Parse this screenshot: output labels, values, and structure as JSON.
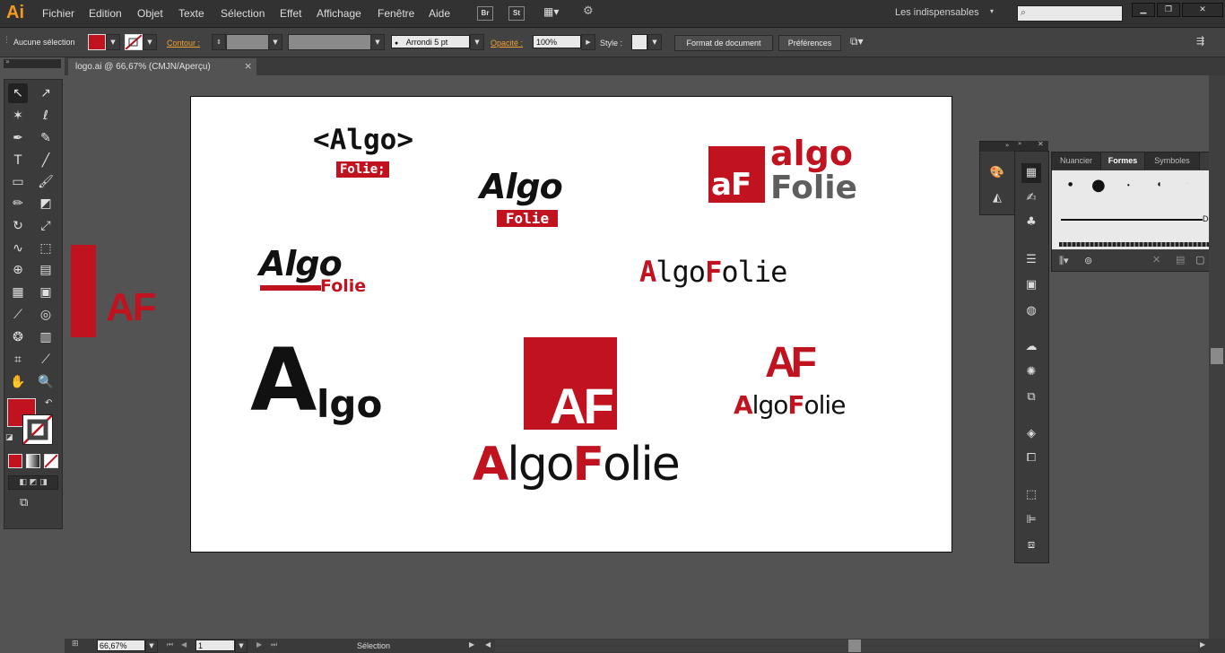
{
  "app": {
    "logo": "Ai"
  },
  "menu": [
    "Fichier",
    "Edition",
    "Objet",
    "Texte",
    "Sélection",
    "Effet",
    "Affichage",
    "Fenêtre",
    "Aide"
  ],
  "menubar_buttons": {
    "bridge": "Br",
    "stock": "St"
  },
  "workspace": "Les indispensables",
  "window_controls": {
    "minimize": "▁",
    "restore": "❐",
    "close": "✕"
  },
  "control_bar": {
    "selection_status": "Aucune sélection",
    "contour_label": "Contour :",
    "brush_value": "Arrondi 5 pt",
    "opacity_label": "Opacité :",
    "opacity_value": "100%",
    "style_label": "Style :",
    "doc_format_button": "Format de document",
    "preferences_button": "Préférences"
  },
  "document_tab": {
    "title": "logo.ai @ 66,67% (CMJN/Aperçu)",
    "close": "×"
  },
  "panel_tabs": [
    "Nuancier",
    "Formes",
    "Symboles"
  ],
  "brush_panel": {
    "brush_name": "De ba"
  },
  "status_bar": {
    "zoom": "66,67%",
    "page": "1",
    "tool": "Sélection"
  },
  "colors": {
    "accent_red": "#c1121f",
    "ui_dark": "#323232",
    "ui_mid": "#535353",
    "app_orange": "#f39a1e"
  },
  "artwork": {
    "offcanvas": "AF",
    "logo1": {
      "line1": "<Algo>",
      "line2": "Folie;"
    },
    "logo2": {
      "line1": "Algo",
      "line2": "Folie"
    },
    "logo3": {
      "mark": "aF",
      "line1": "algo",
      "line2": "Folie"
    },
    "logo4": {
      "line1": "Algo",
      "line2": "Folie"
    },
    "logo5": {
      "a": "A",
      "lgo": "lgo",
      "f": "F",
      "olie": "olie"
    },
    "logo6": {
      "big_a": "A",
      "rest": "lgo"
    },
    "logo7": {
      "mark": "AF",
      "a": "A",
      "lgo": "lgo",
      "f": "F",
      "olie": "olie"
    },
    "logo8": {
      "mark": "AF",
      "a": "A",
      "lgo": "lgo",
      "f": "F",
      "olie": "olie"
    }
  }
}
